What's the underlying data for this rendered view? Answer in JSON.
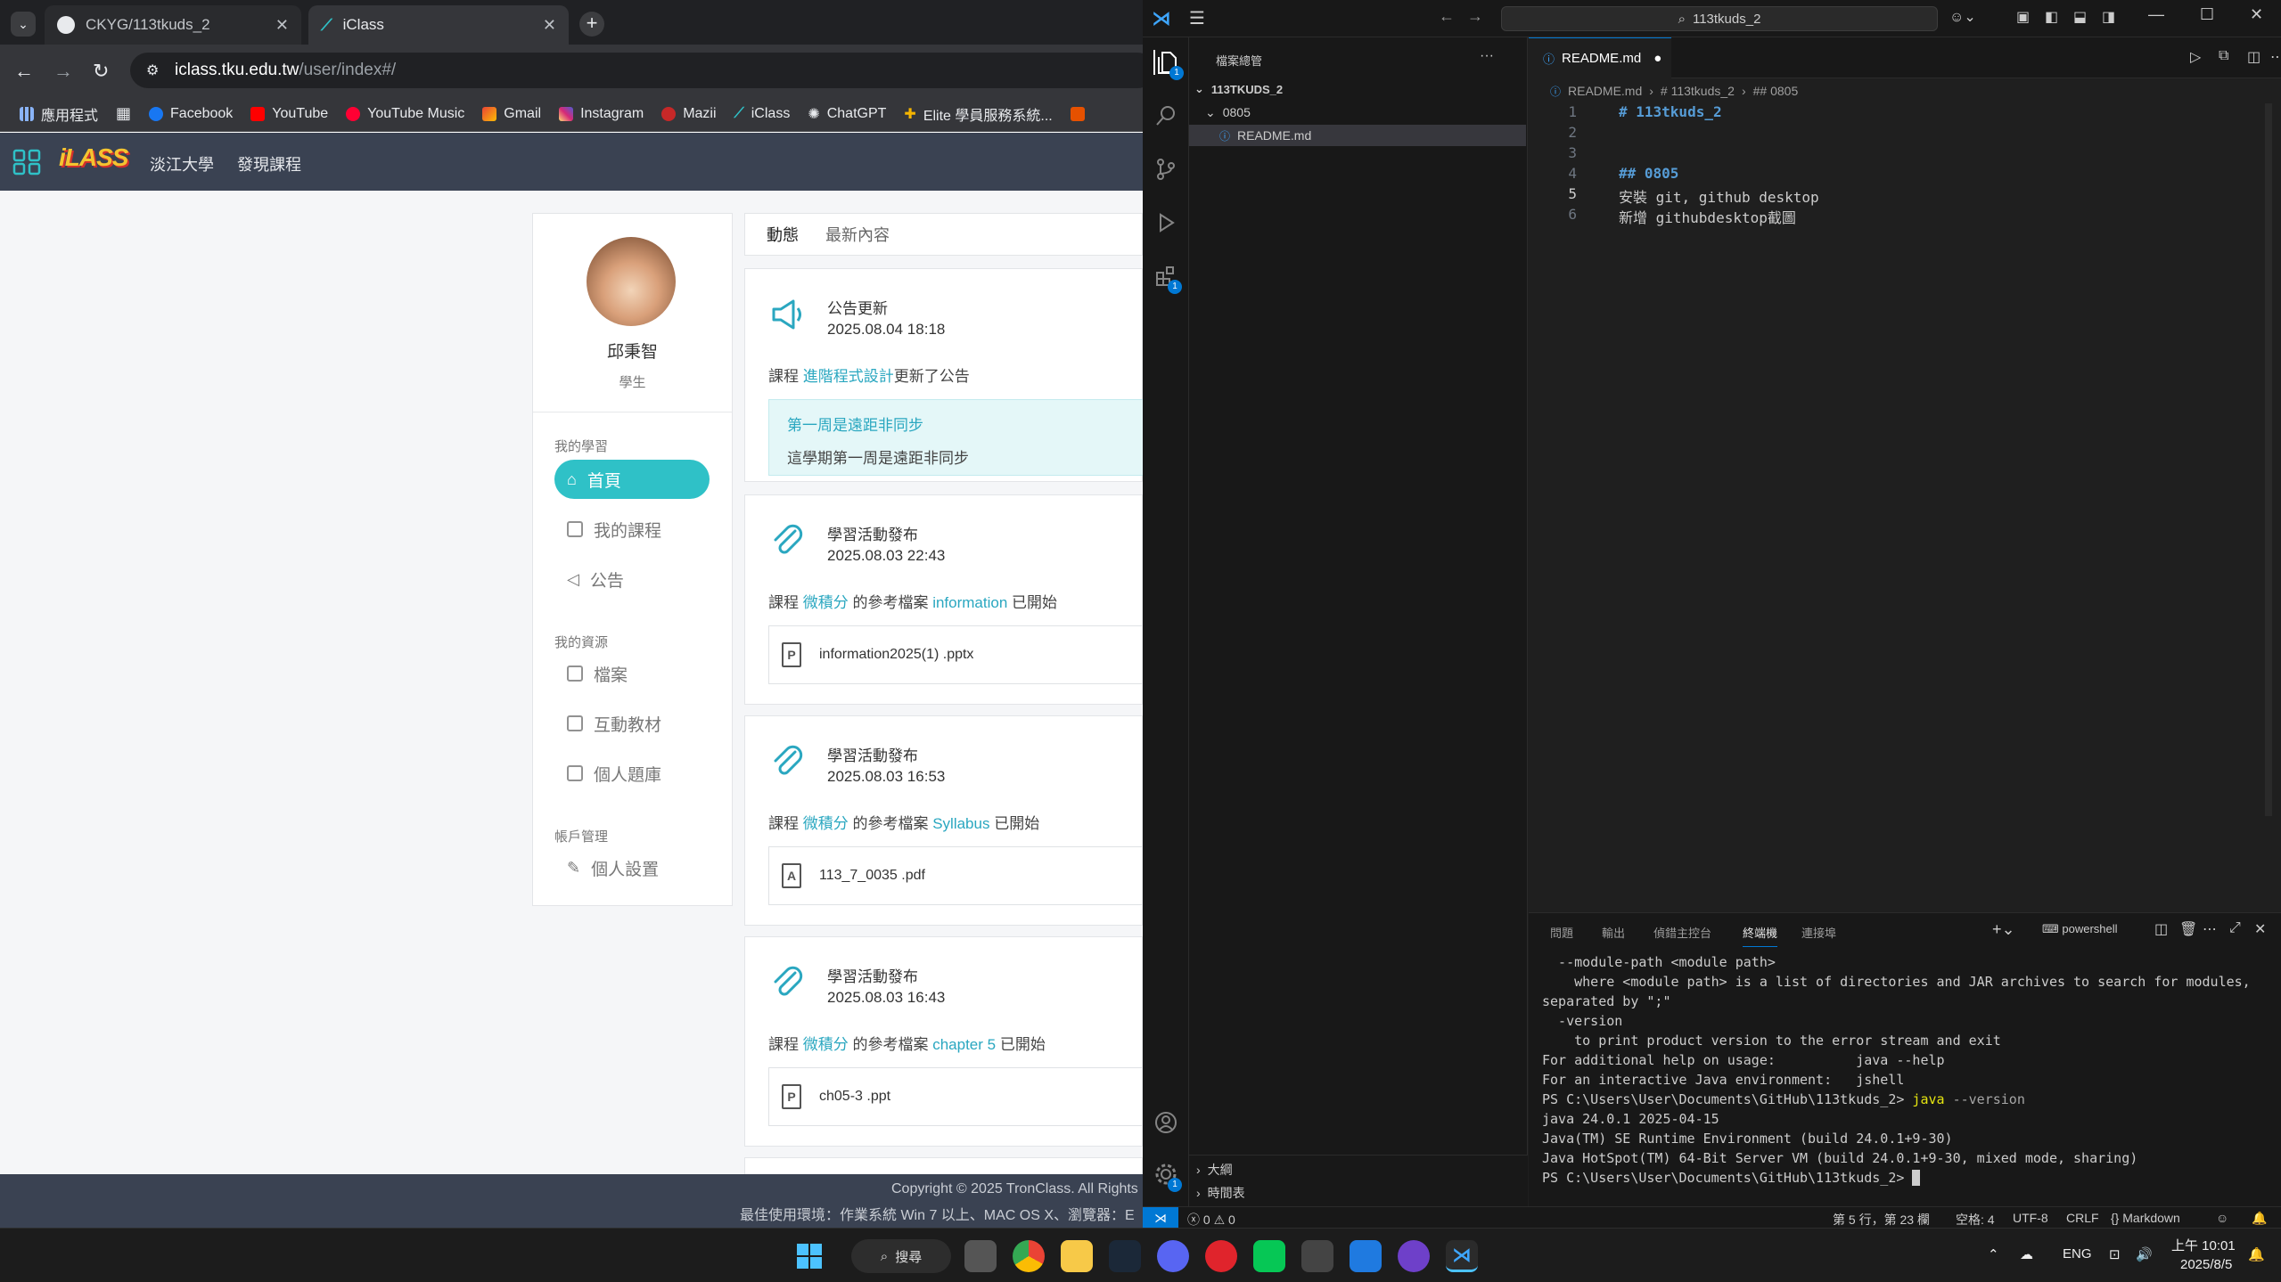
{
  "browser": {
    "tabs": [
      {
        "title": "CKYG/113tkuds_2"
      },
      {
        "title": "iClass"
      }
    ],
    "url": {
      "host": "iclass.tku.edu.tw",
      "path": "/user/index#/"
    },
    "bookmarks": [
      {
        "label": "應用程式",
        "color": "#8ab4f8"
      },
      {
        "label": "Facebook",
        "color": "#1877f2"
      },
      {
        "label": "YouTube",
        "color": "#ff0000"
      },
      {
        "label": "YouTube Music",
        "color": "#ff0033"
      },
      {
        "label": "Gmail",
        "color": "#ea4335"
      },
      {
        "label": "Instagram",
        "color": "#e1306c"
      },
      {
        "label": "Mazii",
        "color": "#c62828"
      },
      {
        "label": "iClass",
        "color": "#2fc1c7"
      },
      {
        "label": "ChatGPT",
        "color": "#cccccc"
      },
      {
        "label": "Elite 學員服務系統...",
        "color": "#f4b400"
      }
    ]
  },
  "iclass": {
    "header_nav": [
      "淡江大學",
      "發現課程"
    ],
    "user": {
      "name": "邱秉智",
      "role": "學生"
    },
    "sections": {
      "learning": "我的學習",
      "resources": "我的資源",
      "account": "帳戶管理"
    },
    "menu": {
      "home": "首頁",
      "courses": "我的課程",
      "announcements": "公告",
      "files": "檔案",
      "interactive": "互動教材",
      "question_bank": "個人題庫",
      "settings": "個人設置"
    },
    "feed_tabs": [
      "動態",
      "最新內容"
    ],
    "feed": [
      {
        "title": "公告更新",
        "date": "2025.08.04 18:18",
        "prefix": "課程",
        "course": "進階程式設計",
        "suffix": "更新了公告",
        "notice_title": "第一周是遠距非同步",
        "notice_body": "這學期第一周是遠距非同步"
      },
      {
        "title": "學習活動發布",
        "date": "2025.08.03 22:43",
        "prefix": "課程",
        "course": "微積分",
        "middle": "的參考檔案",
        "item": "information",
        "suffix": "已開始",
        "file": "information2025(1) .pptx",
        "file_type": "P"
      },
      {
        "title": "學習活動發布",
        "date": "2025.08.03 16:53",
        "prefix": "課程",
        "course": "微積分",
        "middle": "的參考檔案",
        "item": "Syllabus",
        "suffix": "已開始",
        "file": "113_7_0035 .pdf",
        "file_type": "A"
      },
      {
        "title": "學習活動發布",
        "date": "2025.08.03 16:43",
        "prefix": "課程",
        "course": "微積分",
        "middle": "的參考檔案",
        "item": "chapter 5",
        "suffix": "已開始",
        "file": "ch05-3 .ppt",
        "file_type": "P"
      }
    ],
    "footer": {
      "copyright": "Copyright © 2025 TronClass. All Rights",
      "env": "最佳使用環境：作業系統 Win 7 以上、MAC OS X、瀏覽器：E"
    }
  },
  "vscode": {
    "search": "113tkuds_2",
    "explorer": {
      "title": "檔案總管",
      "root": "113TKUDS_2",
      "folder": "0805",
      "file": "README.md"
    },
    "editor_tab": "README.md",
    "breadcrumbs": [
      "README.md",
      "# 113tkuds_2",
      "## 0805"
    ],
    "lines": [
      {
        "n": "1",
        "text": "# 113tkuds_2",
        "heading": true
      },
      {
        "n": "2",
        "text": "",
        "heading": false
      },
      {
        "n": "3",
        "text": "",
        "heading": false
      },
      {
        "n": "4",
        "text": "## 0805",
        "heading": true
      },
      {
        "n": "5",
        "text": "安裝 git, github desktop",
        "heading": false
      },
      {
        "n": "6",
        "text": "新增 githubdesktop截圖",
        "heading": false
      }
    ],
    "panel_tabs": [
      "問題",
      "輸出",
      "偵錯主控台",
      "終端機",
      "連接埠"
    ],
    "terminal_shell": "powershell",
    "terminal": [
      "  --module-path <module path>",
      "    where <module path> is a list of directories and JAR archives to search for modules,",
      "separated by \";\"",
      "  -version",
      "    to print product version to the error stream and exit",
      "",
      "For additional help on usage:          java --help",
      "For an interactive Java environment:   jshell",
      "PS C:\\Users\\User\\Documents\\GitHub\\113tkuds_2> ",
      "java 24.0.1 2025-04-15",
      "Java(TM) SE Runtime Environment (build 24.0.1+9-30)",
      "Java HotSpot(TM) 64-Bit Server VM (build 24.0.1+9-30, mixed mode, sharing)",
      "PS C:\\Users\\User\\Documents\\GitHub\\113tkuds_2> "
    ],
    "terminal_cmd": "java",
    "terminal_opt": "--version",
    "outline": [
      "大綱",
      "時間表"
    ],
    "status": {
      "errors": "0",
      "warnings": "0",
      "position": "第 5 行，第 23 欄",
      "spaces": "空格: 4",
      "encoding": "UTF-8",
      "eol": "CRLF",
      "language": "Markdown"
    }
  },
  "taskbar": {
    "search": "搜尋",
    "lang": "ENG",
    "time": "上午 10:01",
    "date": "2025/8/5"
  }
}
